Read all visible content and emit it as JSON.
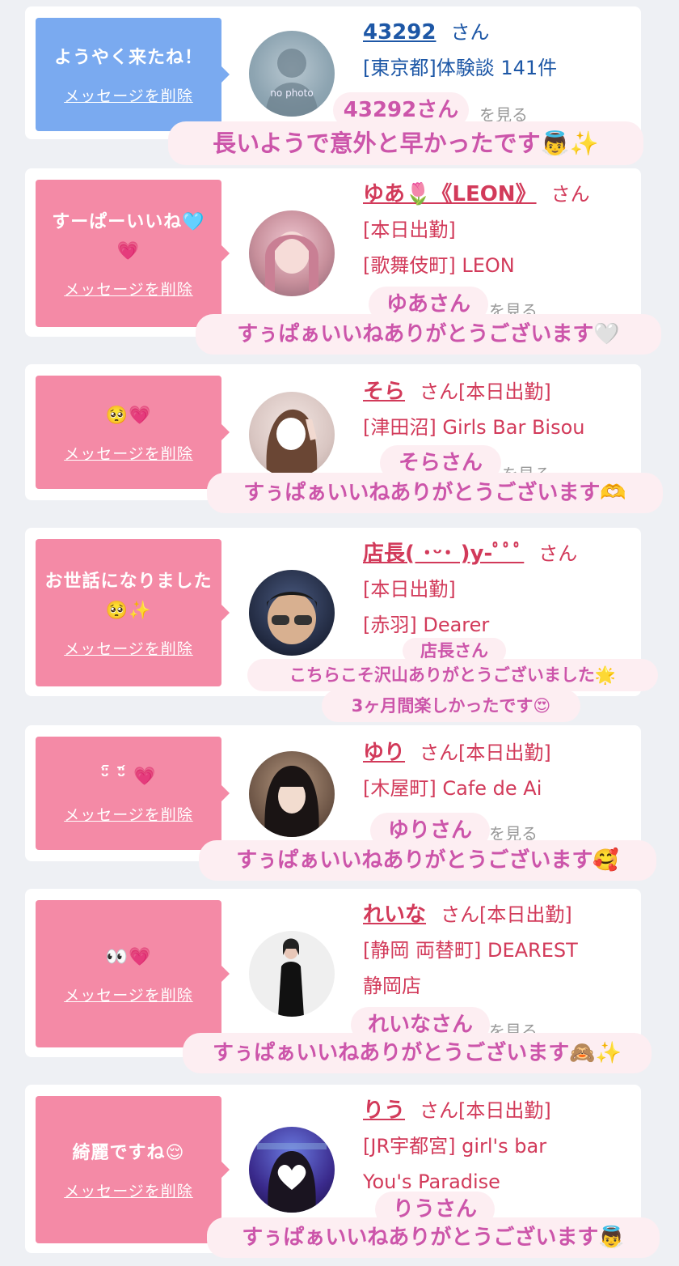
{
  "cards": [
    {
      "message": "ようやく来たね！",
      "delete_label": "メッセージを削除",
      "name": "43292",
      "suffix": "さん",
      "lines": [
        "[東京都]体験談 141件"
      ],
      "faded": "を見る",
      "avatar_text": "no photo",
      "sticker_name": "43292さん",
      "sticker_text": "長いようで意外と早かったです👼✨"
    },
    {
      "message": "すーぱーいいね🩵💗",
      "delete_label": "メッセージを削除",
      "name": "ゆあ🌷《LEON》",
      "suffix": "さん",
      "lines": [
        "[本日出勤]",
        "[歌舞伎町] LEON"
      ],
      "faded": "を見る",
      "sticker_name": "ゆあさん",
      "sticker_text": "すぅぱぁいいねありがとうございます🤍"
    },
    {
      "message": "🥺💗",
      "delete_label": "メッセージを削除",
      "name": "そら",
      "suffix": "さん[本日出勤]",
      "lines": [
        "[津田沼] Girls Bar Bisou"
      ],
      "faded": "を見る",
      "sticker_name": "そらさん",
      "sticker_text": "すぅぱぁいいねありがとうございます🫶"
    },
    {
      "message": "お世話になりました🥺✨",
      "delete_label": "メッセージを削除",
      "name": "店長( ･ᵕ･ )y-ﾟﾟﾟ",
      "suffix": "さん",
      "lines": [
        "[本日出勤]",
        "[赤羽] Dearer"
      ],
      "faded": "",
      "sticker_name": "店長さん",
      "sticker_text": "こちらこそ沢山ありがとうございました🌟",
      "sticker_text2": "3ヶ月間楽しかったです😍"
    },
    {
      "message": "ᵕ̈᷇ ᵕ̈᷄ 💗",
      "delete_label": "メッセージを削除",
      "name": "ゆり",
      "suffix": "さん[本日出勤]",
      "lines": [
        "[木屋町] Cafe de Ai"
      ],
      "faded": "を見る",
      "sticker_name": "ゆりさん",
      "sticker_text": "すぅぱぁいいねありがとうございます🥰"
    },
    {
      "message": "👀💗",
      "delete_label": "メッセージを削除",
      "name": "れいな",
      "suffix": "さん[本日出勤]",
      "lines": [
        "[静岡 両替町] DEAREST",
        "静岡店"
      ],
      "faded": "を見る",
      "sticker_name": "れいなさん",
      "sticker_text": "すぅぱぁいいねありがとうございます🙈✨"
    },
    {
      "message": "綺麗ですね😌",
      "delete_label": "メッセージを削除",
      "name": "りう",
      "suffix": "さん[本日出勤]",
      "lines": [
        "[JR宇都宮] girl's bar",
        "You's Paradise"
      ],
      "faded": "",
      "sticker_name": "りうさん",
      "sticker_text": "すぅぱぁいいねありがとうございます👼"
    }
  ],
  "colors": {
    "bubble_blue": "#7aaaf0",
    "bubble_pink": "#f48aa6",
    "name_pink": "#d23a5a",
    "name_blue": "#1d57a6",
    "sticker_bg": "#fdeef2",
    "sticker_text": "#cc55aa"
  }
}
